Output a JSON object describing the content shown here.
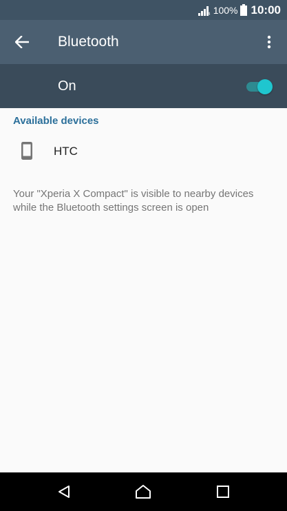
{
  "status_bar": {
    "battery_percent": "100%",
    "time": "10:00"
  },
  "app_bar": {
    "title": "Bluetooth",
    "back_icon": "arrow-back-icon",
    "overflow_icon": "more-vertical-icon"
  },
  "master_switch": {
    "label": "On",
    "checked": true
  },
  "available_devices": {
    "header": "Available devices",
    "items": [
      {
        "name": "HTC",
        "icon": "phone-icon"
      }
    ]
  },
  "visibility_note": "Your \"Xperia X Compact\" is visible to nearby devices while the Bluetooth settings screen is open",
  "nav_bar": {
    "back_icon": "nav-back-icon",
    "home_icon": "nav-home-icon",
    "recents_icon": "nav-recents-icon"
  },
  "colors": {
    "status_bar": "#3f5364",
    "app_bar": "#4b5f71",
    "switch_bar": "#3a4b5a",
    "accent": "#1fc6cf",
    "section_header": "#2b6f9a"
  }
}
